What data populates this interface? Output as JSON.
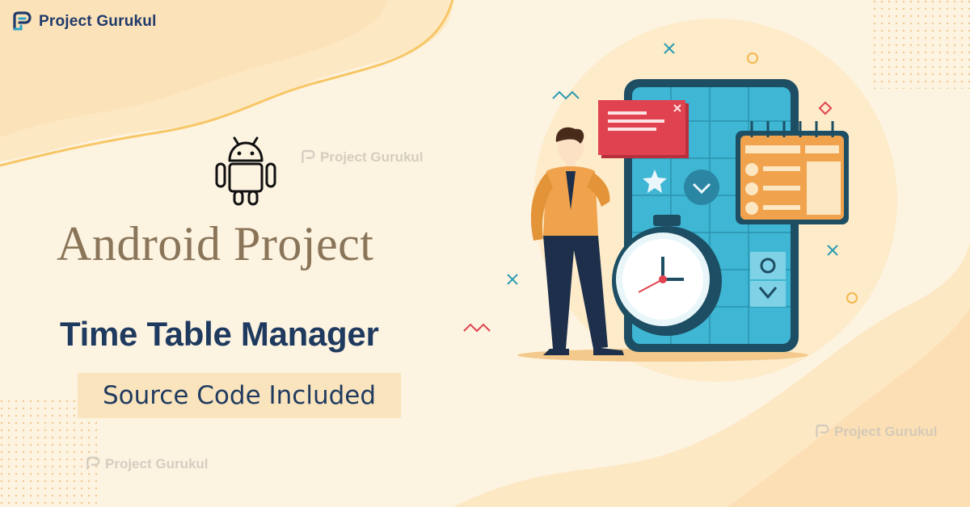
{
  "brand": {
    "name_first": "Project",
    "name_second": "Gurukul"
  },
  "watermarks": [
    "Project Gurukul",
    "Project Gurukul",
    "Project Gurukul"
  ],
  "platform_icon": "android-robot-icon",
  "headline": "Android Project",
  "subheadline": "Time Table Manager",
  "badge": "Source Code Included",
  "colors": {
    "background": "#fdf3e1",
    "headline": "#8a7558",
    "subheadline": "#1f3a5f",
    "badge_bg": "#fae4bd",
    "phone_frame": "#1d4e63",
    "phone_screen": "#3fb6d3",
    "card_red": "#e0434f",
    "card_orange": "#f0a24c"
  },
  "illustration_icons": [
    "smartphone-icon",
    "stopwatch-icon",
    "calendar-icon",
    "notification-card-icon",
    "star-icon",
    "chevron-down-icon",
    "gear-icon",
    "person-figure"
  ]
}
